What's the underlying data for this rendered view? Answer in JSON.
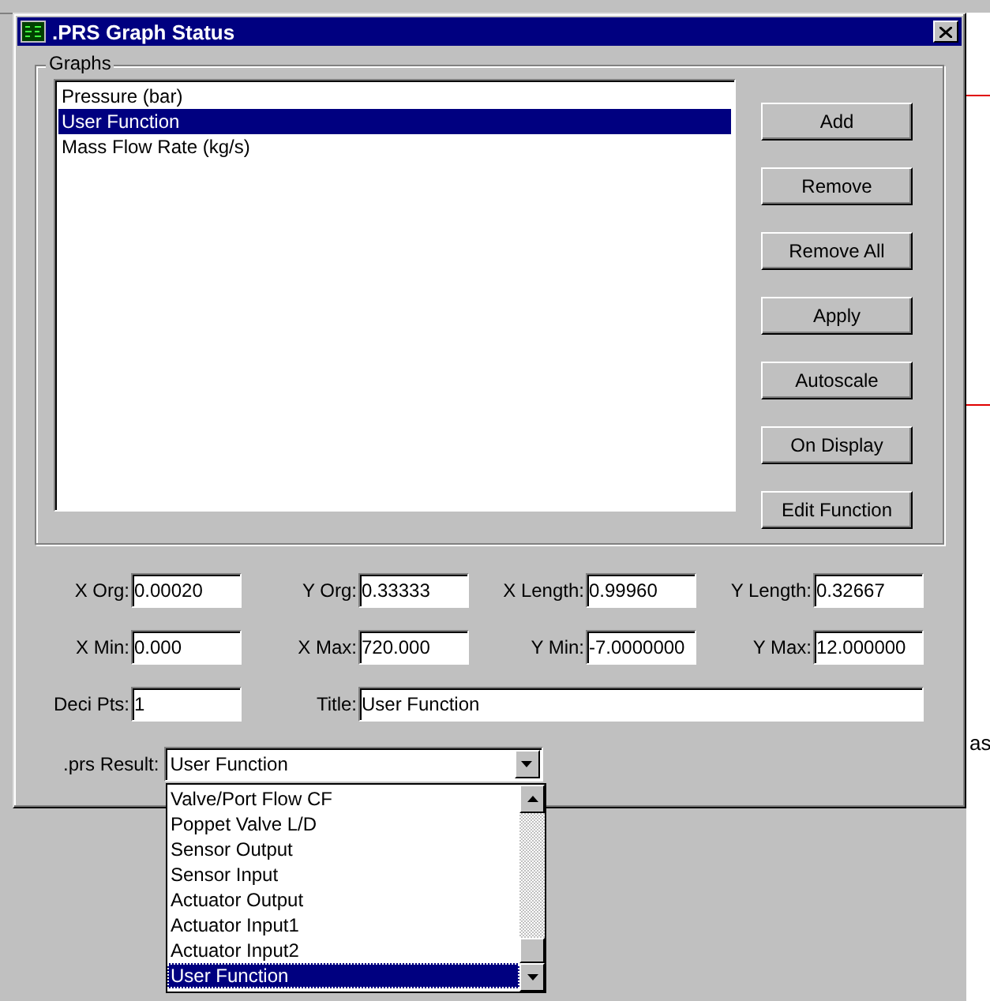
{
  "window": {
    "title": ".PRS Graph Status"
  },
  "graphs": {
    "label": "Graphs",
    "items": [
      {
        "label": "Pressure (bar)",
        "selected": false
      },
      {
        "label": "User Function",
        "selected": true
      },
      {
        "label": "Mass Flow Rate (kg/s)",
        "selected": false
      }
    ]
  },
  "buttons": [
    "Add",
    "Remove",
    "Remove All",
    "Apply",
    "Autoscale",
    "On Display",
    "Edit Function"
  ],
  "field_rows": [
    [
      {
        "label": "X Org:",
        "value": "0.00020",
        "kind": "short"
      },
      {
        "label": "Y Org:",
        "value": "0.33333",
        "kind": "short"
      },
      {
        "label": "X Length:",
        "value": "0.99960",
        "kind": "short"
      },
      {
        "label": "Y Length:",
        "value": "0.32667",
        "kind": "short"
      }
    ],
    [
      {
        "label": "X Min:",
        "value": "0.000",
        "kind": "short"
      },
      {
        "label": "X Max:",
        "value": "720.000",
        "kind": "short"
      },
      {
        "label": "Y Min:",
        "value": "-7.0000000",
        "kind": "short"
      },
      {
        "label": "Y Max:",
        "value": "12.000000",
        "kind": "short"
      }
    ],
    [
      {
        "label": "Deci Pts:",
        "value": "1",
        "kind": "short"
      },
      {
        "label": "Title:",
        "value": "User Function",
        "kind": "wide"
      }
    ]
  ],
  "prs_result": {
    "label": ".prs Result:",
    "value": "User Function",
    "expanded": true,
    "options": [
      {
        "label": "Valve/Port Flow CF",
        "selected": false
      },
      {
        "label": "Poppet Valve L/D",
        "selected": false
      },
      {
        "label": "Sensor Output",
        "selected": false
      },
      {
        "label": "Sensor Input",
        "selected": false
      },
      {
        "label": "Actuator Output",
        "selected": false
      },
      {
        "label": "Actuator Input1",
        "selected": false
      },
      {
        "label": "Actuator Input2",
        "selected": false
      },
      {
        "label": "User Function",
        "selected": true
      }
    ]
  },
  "background_text": "as"
}
